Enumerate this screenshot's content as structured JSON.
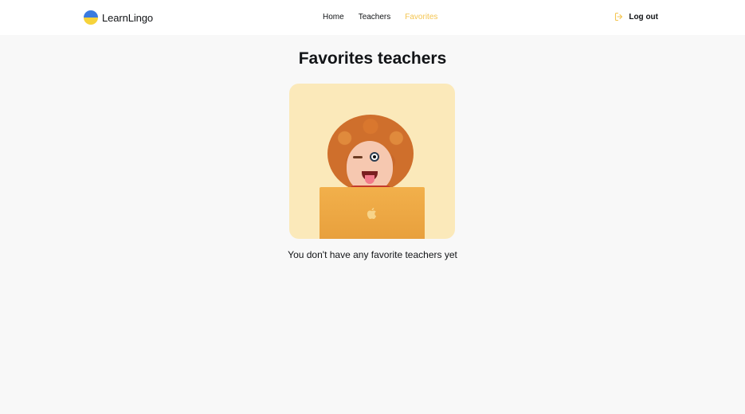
{
  "header": {
    "brand": "LearnLingo",
    "nav": [
      {
        "label": "Home",
        "active": false
      },
      {
        "label": "Teachers",
        "active": false
      },
      {
        "label": "Favorites",
        "active": true
      }
    ],
    "logout_label": "Log out",
    "accent_color": "#f4c550"
  },
  "main": {
    "title": "Favorites teachers",
    "empty_message": "You don't have any favorite teachers yet"
  }
}
